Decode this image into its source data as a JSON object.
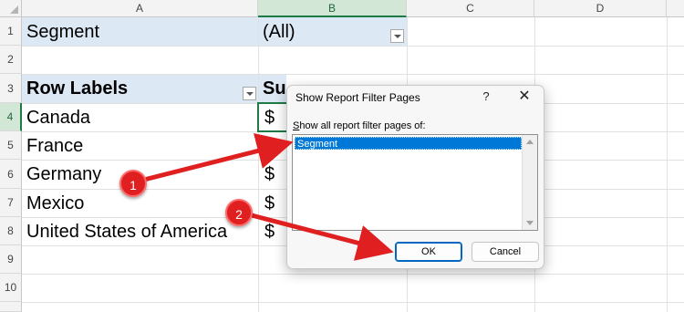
{
  "columns": [
    "A",
    "B",
    "C",
    "D"
  ],
  "rows": [
    "1",
    "2",
    "3",
    "4",
    "5",
    "6",
    "7",
    "8",
    "9",
    "10"
  ],
  "cells": {
    "a1": "Segment",
    "b1": "(All)",
    "a3": "Row Labels",
    "b3": "Sum of Profit",
    "row_labels": [
      "Canada",
      "France",
      "Germany",
      "Mexico",
      "United States of America"
    ],
    "dollar": "$"
  },
  "dialog": {
    "title": "Show Report Filter Pages",
    "help": "?",
    "close": "✕",
    "label_underlined": "S",
    "label_rest": "how all report filter pages of:",
    "list_items": [
      "Segment"
    ],
    "ok": "OK",
    "cancel": "Cancel"
  },
  "annotations": {
    "badge1": "1",
    "badge2": "2"
  },
  "colors": {
    "excel_green": "#1e7b45",
    "filter_fill": "#dde8f5",
    "annotation_red": "#e02020",
    "selection_blue": "#0078d7"
  }
}
